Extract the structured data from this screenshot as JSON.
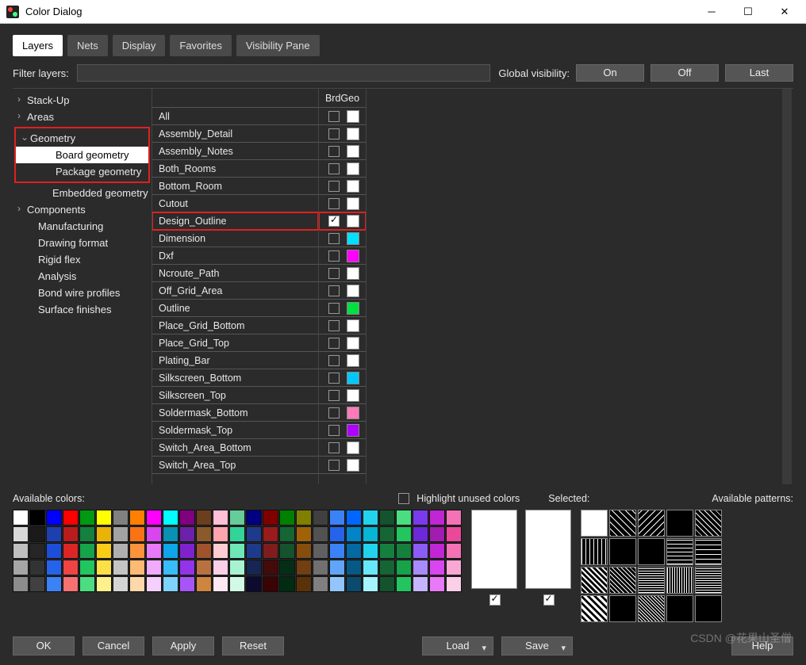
{
  "window": {
    "title": "Color Dialog"
  },
  "tabs": [
    "Layers",
    "Nets",
    "Display",
    "Favorites",
    "Visibility Pane"
  ],
  "activeTab": 0,
  "filter": {
    "label": "Filter layers:",
    "value": ""
  },
  "globalVis": {
    "label": "Global visibility:",
    "buttons": [
      "On",
      "Off",
      "Last"
    ]
  },
  "tree": [
    {
      "label": "Stack-Up",
      "lvl": 1,
      "expander": true
    },
    {
      "label": "Areas",
      "lvl": 1,
      "expander": true
    },
    {
      "label": "Geometry",
      "lvl": 1,
      "expander": true,
      "expanded": true,
      "redGroupStart": true
    },
    {
      "label": "Board geometry",
      "lvl": 3,
      "selected": true
    },
    {
      "label": "Package geometry",
      "lvl": 3,
      "redGroupEnd": true
    },
    {
      "label": "Embedded geometry",
      "lvl": 3
    },
    {
      "label": "Components",
      "lvl": 1,
      "expander": true
    },
    {
      "label": "Manufacturing",
      "lvl": 2
    },
    {
      "label": "Drawing format",
      "lvl": 2
    },
    {
      "label": "Rigid flex",
      "lvl": 2
    },
    {
      "label": "Analysis",
      "lvl": 2
    },
    {
      "label": "Bond wire profiles",
      "lvl": 2
    },
    {
      "label": "Surface finishes",
      "lvl": 2
    }
  ],
  "columnHeader": "BrdGeo",
  "rows": [
    {
      "label": "All",
      "checked": false,
      "color": "#ffffff"
    },
    {
      "label": "Assembly_Detail",
      "checked": false,
      "color": "#ffffff"
    },
    {
      "label": "Assembly_Notes",
      "checked": false,
      "color": "#ffffff"
    },
    {
      "label": "Both_Rooms",
      "checked": false,
      "color": "#ffffff"
    },
    {
      "label": "Bottom_Room",
      "checked": false,
      "color": "#ffffff"
    },
    {
      "label": "Cutout",
      "checked": false,
      "color": "#ffffff"
    },
    {
      "label": "Design_Outline",
      "checked": true,
      "color": "#ffffff",
      "highlight": true
    },
    {
      "label": "Dimension",
      "checked": false,
      "color": "#00e0ff"
    },
    {
      "label": "Dxf",
      "checked": false,
      "color": "#ff00ff"
    },
    {
      "label": "Ncroute_Path",
      "checked": false,
      "color": "#ffffff"
    },
    {
      "label": "Off_Grid_Area",
      "checked": false,
      "color": "#ffffff"
    },
    {
      "label": "Outline",
      "checked": false,
      "color": "#00e040"
    },
    {
      "label": "Place_Grid_Bottom",
      "checked": false,
      "color": "#ffffff"
    },
    {
      "label": "Place_Grid_Top",
      "checked": false,
      "color": "#ffffff"
    },
    {
      "label": "Plating_Bar",
      "checked": false,
      "color": "#ffffff"
    },
    {
      "label": "Silkscreen_Bottom",
      "checked": false,
      "color": "#00c8ff"
    },
    {
      "label": "Silkscreen_Top",
      "checked": false,
      "color": "#ffffff"
    },
    {
      "label": "Soldermask_Bottom",
      "checked": false,
      "color": "#ff7ab8"
    },
    {
      "label": "Soldermask_Top",
      "checked": false,
      "color": "#b000ff"
    },
    {
      "label": "Switch_Area_Bottom",
      "checked": false,
      "color": "#ffffff"
    },
    {
      "label": "Switch_Area_Top",
      "checked": false,
      "color": "#ffffff"
    }
  ],
  "labels": {
    "availColors": "Available colors:",
    "highlightUnused": "Highlight unused colors",
    "selected": "Selected:",
    "availPatterns": "Available patterns:"
  },
  "palette": [
    "#ffffff",
    "#000000",
    "#0000ff",
    "#ff0000",
    "#009911",
    "#ffff00",
    "#808080",
    "#ff8000",
    "#ff00ff",
    "#00ffff",
    "#800080",
    "#6b3e1e",
    "#ffbfd7",
    "#66cc99",
    "#000080",
    "#800000",
    "#008000",
    "#808000",
    "#404040",
    "#3b82f6",
    "#0066ff",
    "#22d3ee",
    "#14532d",
    "#4ade80",
    "#7c3aed",
    "#c026d3",
    "#f472b6",
    "#d9d9d9",
    "#1a1a1a",
    "#1e40af",
    "#b91c1c",
    "#15803d",
    "#eab308",
    "#a3a3a3",
    "#f97316",
    "#d946ef",
    "#0891b2",
    "#6b21a8",
    "#8b5a2b",
    "#fda4af",
    "#34d399",
    "#1e3a8a",
    "#991b1b",
    "#166534",
    "#a16207",
    "#525252",
    "#2563eb",
    "#0284c7",
    "#06b6d4",
    "#166534",
    "#22c55e",
    "#6d28d9",
    "#a21caf",
    "#ec4899",
    "#bfbfbf",
    "#262626",
    "#1d4ed8",
    "#dc2626",
    "#16a34a",
    "#facc15",
    "#b0b0b0",
    "#fb923c",
    "#e879f9",
    "#0ea5e9",
    "#7e22ce",
    "#a0522d",
    "#fecdd3",
    "#6ee7b7",
    "#1e3a8a",
    "#7f1d1d",
    "#14532d",
    "#854d0e",
    "#606060",
    "#3b82f6",
    "#0369a1",
    "#22d3ee",
    "#15803d",
    "#15803d",
    "#8b5cf6",
    "#c026d3",
    "#f472b6",
    "#a6a6a6",
    "#333333",
    "#2563eb",
    "#ef4444",
    "#22c55e",
    "#fde047",
    "#c4c4c4",
    "#fdba74",
    "#f0abfc",
    "#38bdf8",
    "#9333ea",
    "#b97142",
    "#fbcfe8",
    "#a7f3d0",
    "#172554",
    "#450a0a",
    "#052e16",
    "#713f12",
    "#707070",
    "#60a5fa",
    "#075985",
    "#67e8f9",
    "#166534",
    "#16a34a",
    "#a78bfa",
    "#d946ef",
    "#f9a8d4",
    "#8c8c8c",
    "#404040",
    "#3b82f6",
    "#f87171",
    "#4ade80",
    "#fef08a",
    "#d4d4d4",
    "#fed7aa",
    "#f5d0fe",
    "#7dd3fc",
    "#a855f7",
    "#cd853f",
    "#fce7f3",
    "#d1fae5",
    "#0c0a2e",
    "#3b0404",
    "#022c12",
    "#5a3208",
    "#808080",
    "#93c5fd",
    "#0c4a6e",
    "#a5f3fc",
    "#14532d",
    "#22c55e",
    "#c4b5fd",
    "#e879f9",
    "#fbcfe8"
  ],
  "buttons": {
    "ok": "OK",
    "cancel": "Cancel",
    "apply": "Apply",
    "reset": "Reset",
    "load": "Load",
    "save": "Save",
    "help": "Help"
  },
  "watermark": "CSDN @花果山圣僧"
}
